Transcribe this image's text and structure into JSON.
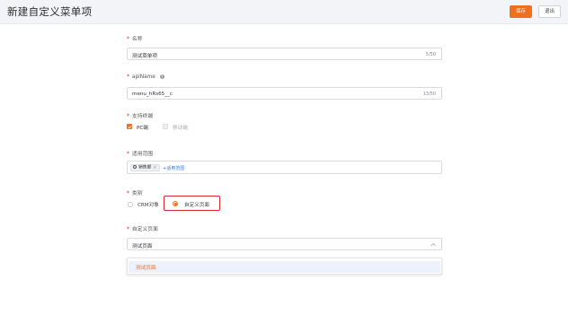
{
  "header": {
    "title": "新建自定义菜单项",
    "save_label": "保存",
    "exit_label": "退出"
  },
  "form": {
    "name": {
      "label": "名称",
      "value": "测试菜单项",
      "count": "5/50"
    },
    "api_name": {
      "label": "apiName",
      "value": "menu_hRs65__c",
      "count": "13/50"
    },
    "terminals": {
      "label": "支持终端",
      "options": [
        {
          "label": "PC端",
          "checked": true
        },
        {
          "label": "移动端",
          "checked": false
        }
      ]
    },
    "scope": {
      "label": "适用范围",
      "tag": "销售部",
      "tag_remove": "×",
      "add_label": "+适用范围"
    },
    "category": {
      "label": "类别",
      "options": [
        {
          "label": "CRM对象",
          "selected": false
        },
        {
          "label": "自定义页面",
          "selected": true
        }
      ]
    },
    "custom_page": {
      "label": "自定义页面",
      "value": "测试页面",
      "dropdown_options": [
        "测试页面"
      ]
    }
  },
  "colors": {
    "accent": "#ee6f1e",
    "required": "#e1251b",
    "highlight_box": "#d62b2b",
    "link": "#3a7bd5"
  }
}
